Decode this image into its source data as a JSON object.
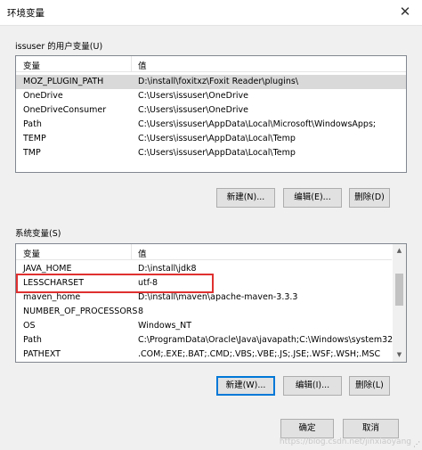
{
  "window": {
    "title": "环境变量",
    "close_glyph": "✕"
  },
  "user_section": {
    "label": "issuser 的用户变量(U)",
    "columns": [
      "变量",
      "值"
    ],
    "rows": [
      {
        "name": "MOZ_PLUGIN_PATH",
        "value": "D:\\install\\foxitxz\\Foxit Reader\\plugins\\"
      },
      {
        "name": "OneDrive",
        "value": "C:\\Users\\issuser\\OneDrive"
      },
      {
        "name": "OneDriveConsumer",
        "value": "C:\\Users\\issuser\\OneDrive"
      },
      {
        "name": "Path",
        "value": "C:\\Users\\issuser\\AppData\\Local\\Microsoft\\WindowsApps;"
      },
      {
        "name": "TEMP",
        "value": "C:\\Users\\issuser\\AppData\\Local\\Temp"
      },
      {
        "name": "TMP",
        "value": "C:\\Users\\issuser\\AppData\\Local\\Temp"
      }
    ],
    "buttons": {
      "new": "新建(N)...",
      "edit": "编辑(E)...",
      "delete": "删除(D)"
    }
  },
  "system_section": {
    "label": "系统变量(S)",
    "columns": [
      "变量",
      "值"
    ],
    "rows": [
      {
        "name": "JAVA_HOME",
        "value": "D:\\install\\jdk8"
      },
      {
        "name": "LESSCHARSET",
        "value": "utf-8"
      },
      {
        "name": "maven_home",
        "value": "D:\\install\\maven\\apache-maven-3.3.3"
      },
      {
        "name": "NUMBER_OF_PROCESSORS",
        "value": "8"
      },
      {
        "name": "OS",
        "value": "Windows_NT"
      },
      {
        "name": "Path",
        "value": "C:\\ProgramData\\Oracle\\Java\\javapath;C:\\Windows\\system32;..."
      },
      {
        "name": "PATHEXT",
        "value": ".COM;.EXE;.BAT;.CMD;.VBS;.VBE;.JS;.JSE;.WSF;.WSH;.MSC"
      }
    ],
    "buttons": {
      "new": "新建(W)...",
      "edit": "编辑(I)...",
      "delete": "删除(L)"
    }
  },
  "footer": {
    "ok": "确定",
    "cancel": "取消"
  },
  "watermark": "https://blog.csdn.net/jinxiaoyang"
}
